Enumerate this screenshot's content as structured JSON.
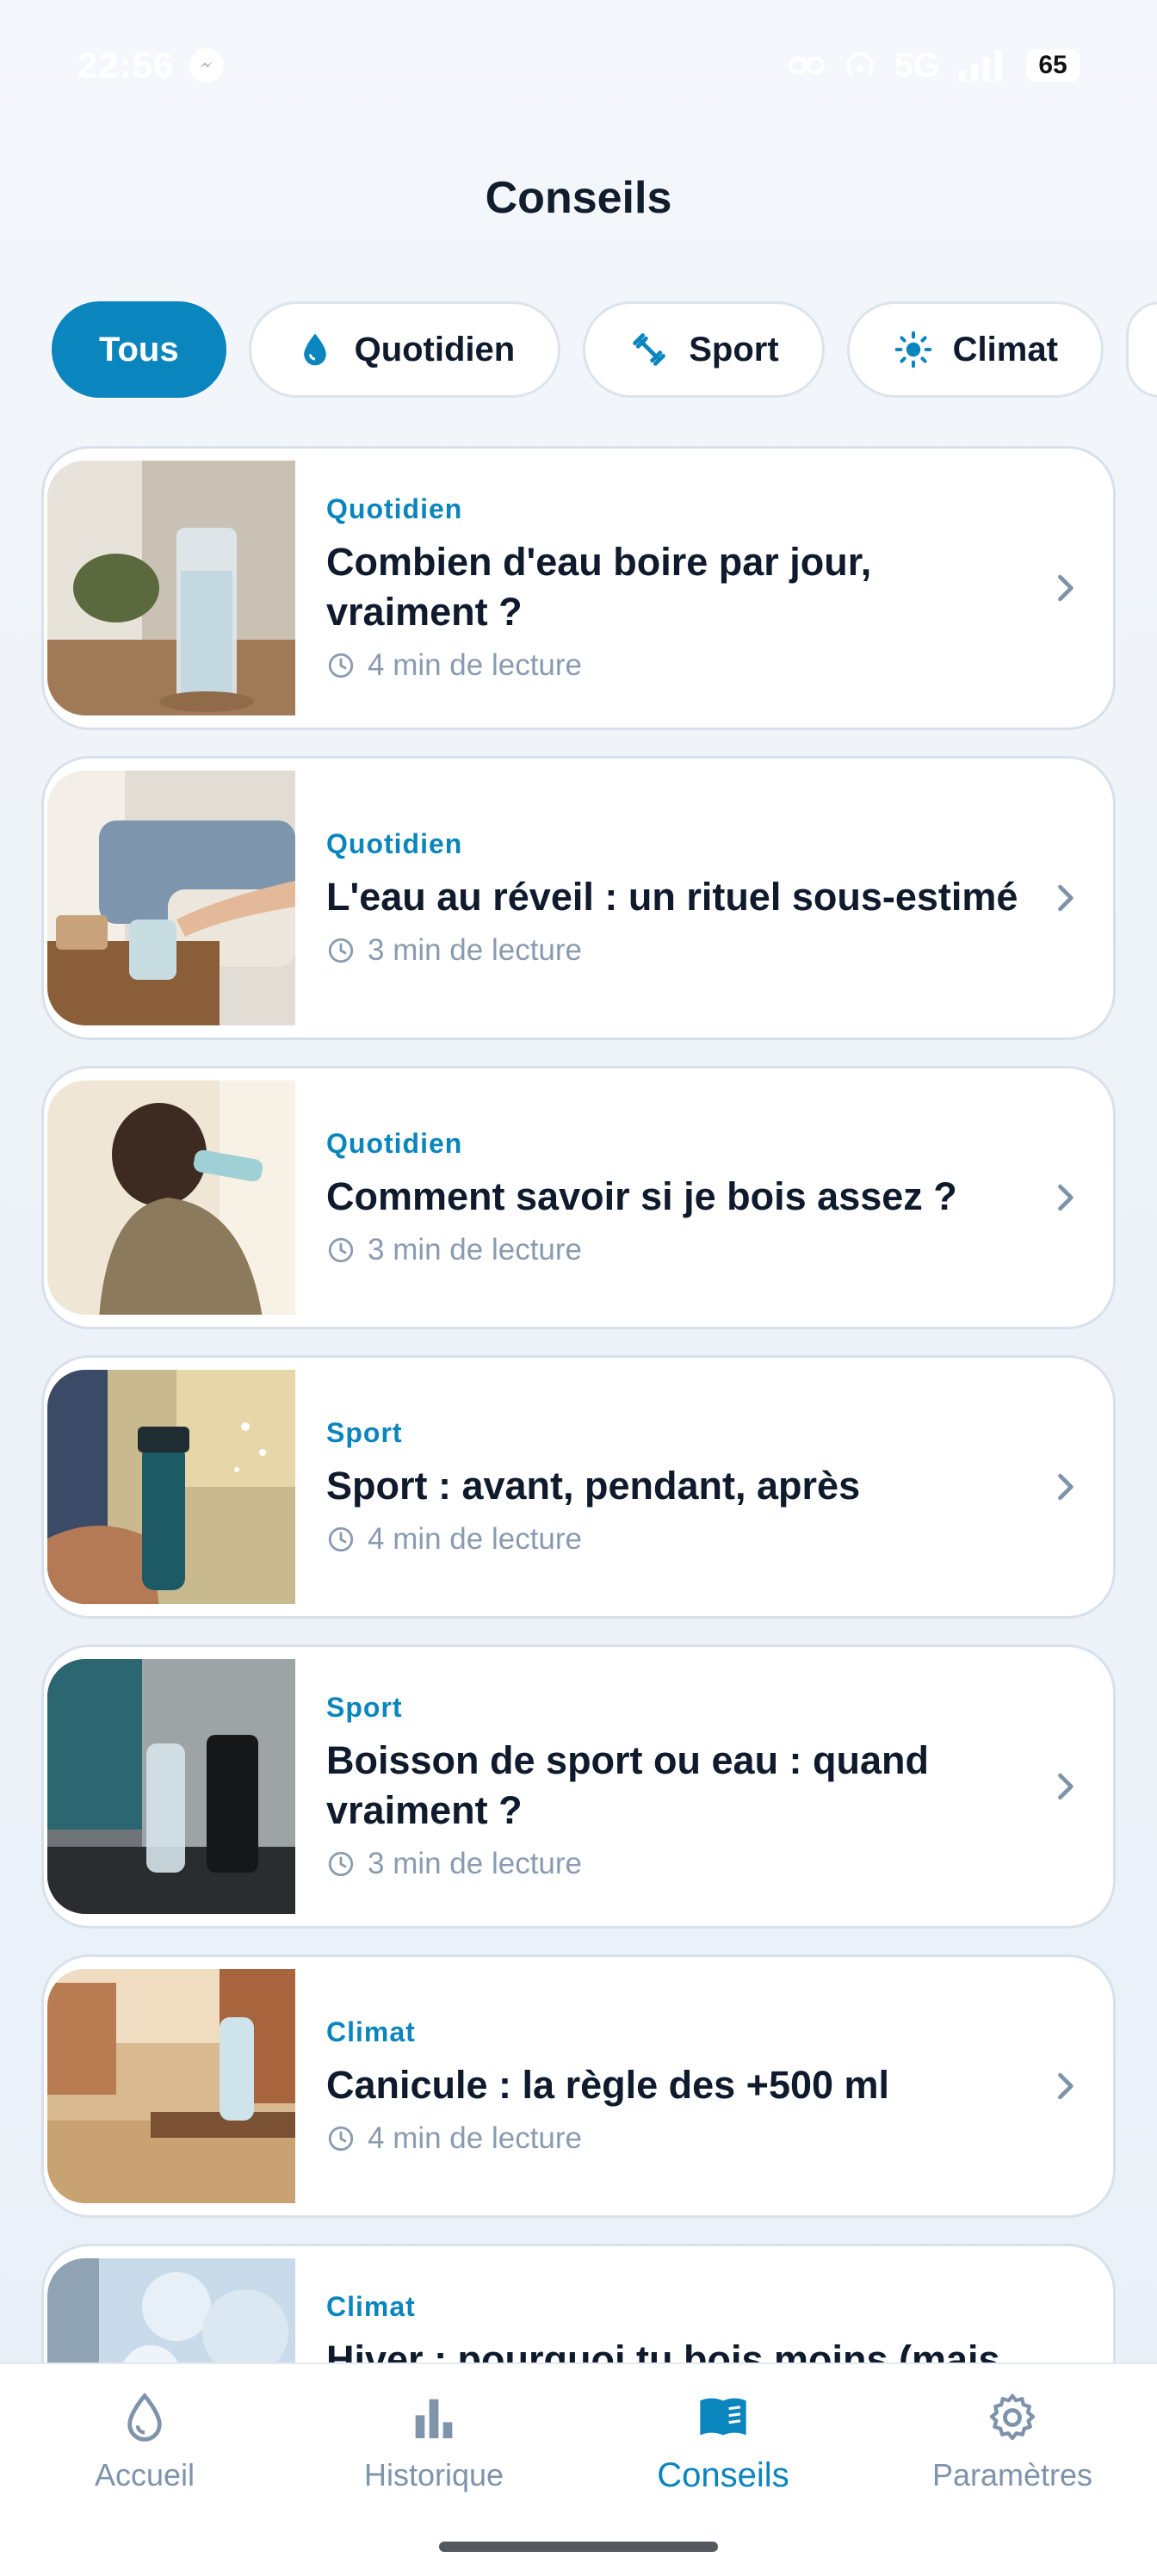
{
  "status_bar": {
    "time": "22:56",
    "network": "5G",
    "battery": "65",
    "icons": [
      "messenger-icon",
      "link-icon",
      "hotspot-icon",
      "signal-icon",
      "battery-icon"
    ]
  },
  "header": {
    "title": "Conseils"
  },
  "filters": {
    "items": [
      {
        "label": "Tous",
        "icon": "",
        "active": true
      },
      {
        "label": "Quotidien",
        "icon": "drop-icon",
        "active": false
      },
      {
        "label": "Sport",
        "icon": "dumbbell-icon",
        "active": false
      },
      {
        "label": "Climat",
        "icon": "sun-icon",
        "active": false
      }
    ]
  },
  "articles": [
    {
      "category": "Quotidien",
      "title": "Combien d'eau boire par jour, vraiment ?",
      "read_time": "4 min de lecture",
      "image": "glass-of-water-on-table"
    },
    {
      "category": "Quotidien",
      "title": "L'eau au réveil : un rituel sous-estimé",
      "read_time": "3 min de lecture",
      "image": "bedside-glass-alarm-clock"
    },
    {
      "category": "Quotidien",
      "title": "Comment savoir si je bois assez ?",
      "read_time": "3 min de lecture",
      "image": "woman-drinking-bottle"
    },
    {
      "category": "Sport",
      "title": "Sport : avant, pendant, après",
      "read_time": "4 min de lecture",
      "image": "runner-opening-bottle"
    },
    {
      "category": "Sport",
      "title": "Boisson de sport ou eau : quand vraiment ?",
      "read_time": "3 min de lecture",
      "image": "gym-bottle-shaker"
    },
    {
      "category": "Climat",
      "title": "Canicule : la règle des +500 ml",
      "read_time": "4 min de lecture",
      "image": "street-bench-bottle"
    },
    {
      "category": "Climat",
      "title": "Hiver : pourquoi tu bois moins (mais",
      "read_time": "",
      "image": "winter-window"
    }
  ],
  "bottom_nav": {
    "items": [
      {
        "label": "Accueil",
        "icon": "drop-icon",
        "active": false
      },
      {
        "label": "Historique",
        "icon": "bar-chart-icon",
        "active": false
      },
      {
        "label": "Conseils",
        "icon": "book-icon",
        "active": true
      },
      {
        "label": "Paramètres",
        "icon": "gear-icon",
        "active": false
      }
    ]
  },
  "colors": {
    "accent": "#0b85bd",
    "text": "#0f1b2d",
    "muted": "#8a9bb0",
    "nav_inactive": "#7f93ab"
  }
}
